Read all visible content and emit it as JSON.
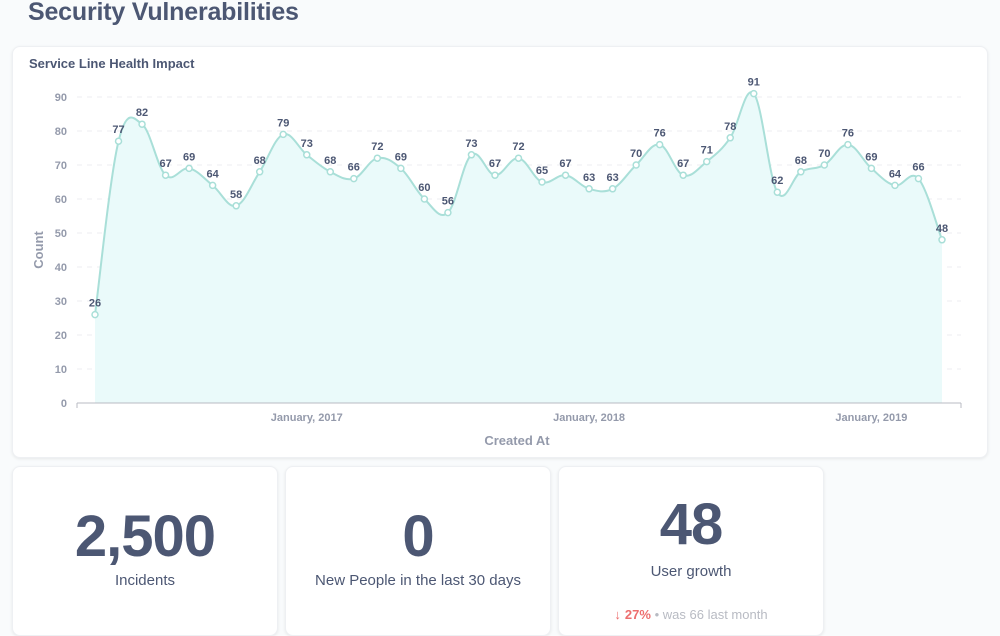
{
  "page": {
    "title": "Security Vulnerabilities"
  },
  "chart_card": {
    "title": "Service Line Health Impact"
  },
  "chart_data": {
    "type": "area",
    "title": "Service Line Health Impact",
    "xlabel": "Created At",
    "ylabel": "Count",
    "ylim": [
      0,
      90
    ],
    "yticks": [
      0,
      10,
      20,
      30,
      40,
      50,
      60,
      70,
      80,
      90
    ],
    "grid": true,
    "x": [
      "2016-04",
      "2016-05",
      "2016-06",
      "2016-07",
      "2016-08",
      "2016-09",
      "2016-10",
      "2016-11",
      "2016-12",
      "2017-01",
      "2017-02",
      "2017-03",
      "2017-04",
      "2017-05",
      "2017-06",
      "2017-07",
      "2017-08",
      "2017-09",
      "2017-10",
      "2017-11",
      "2017-12",
      "2018-01",
      "2018-02",
      "2018-03",
      "2018-04",
      "2018-05",
      "2018-06",
      "2018-07",
      "2018-08",
      "2018-09",
      "2018-10",
      "2018-11",
      "2018-12",
      "2019-01",
      "2019-02",
      "2019-03",
      "2019-04"
    ],
    "xticks": [
      {
        "index": 9,
        "label": "January, 2017"
      },
      {
        "index": 21,
        "label": "January, 2018"
      },
      {
        "index": 33,
        "label": "January, 2019"
      }
    ],
    "series": [
      {
        "name": "Count",
        "color": "#a9dfd8",
        "fill": "#eafafa",
        "values": [
          26,
          77,
          82,
          67,
          69,
          64,
          58,
          68,
          79,
          73,
          68,
          66,
          72,
          69,
          60,
          56,
          73,
          67,
          72,
          65,
          67,
          63,
          63,
          70,
          76,
          67,
          71,
          78,
          91,
          62,
          68,
          70,
          76,
          69,
          64,
          66,
          48
        ]
      }
    ]
  },
  "scalars": [
    {
      "value": "2,500",
      "title": "Incidents"
    },
    {
      "value": "0",
      "title": "New People in the last 30 days"
    },
    {
      "value": "48",
      "title": "User growth",
      "compare": {
        "arrow": "↓",
        "percent": "27%",
        "separator": "•",
        "was_text": "was 66",
        "period": "last month"
      }
    }
  ],
  "colors": {
    "text": "#4c5773",
    "muted": "#949aab",
    "negative": "#ed6e6e",
    "line": "#a9dfd8",
    "area": "#eafafa"
  }
}
